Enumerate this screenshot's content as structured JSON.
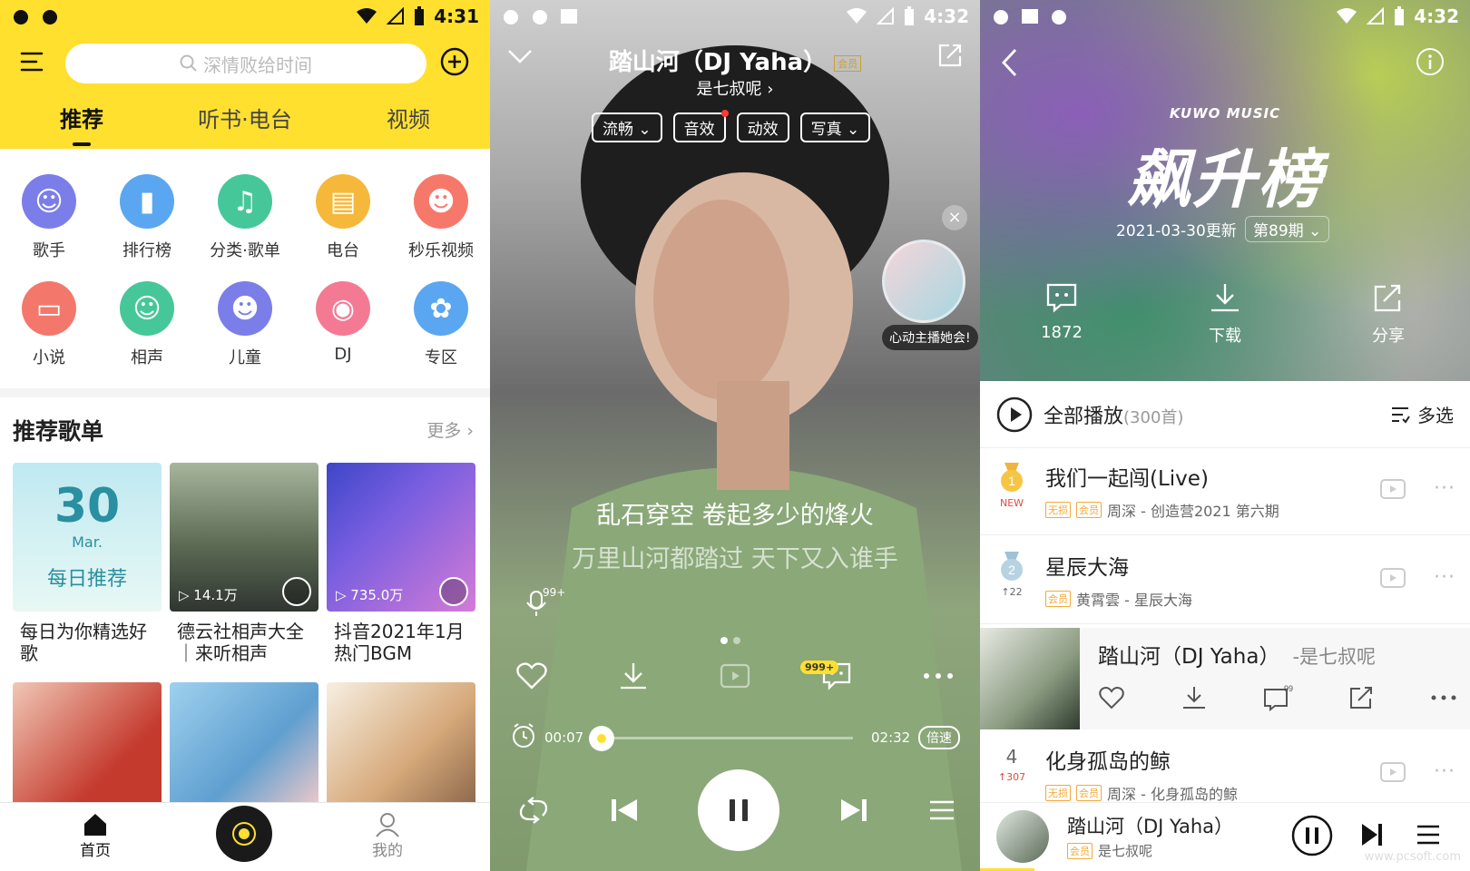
{
  "colors": {
    "accent": "#ffe02f",
    "text": "#222222",
    "muted": "#999999",
    "vip": "#f2a93b"
  },
  "status": {
    "time1": "4:31",
    "time2": "4:32",
    "time3": "4:32"
  },
  "home": {
    "search_placeholder": "深情败给时间",
    "tabs": [
      "推荐",
      "听书·电台",
      "视频"
    ],
    "categories": [
      {
        "label": "歌手",
        "icon": "singer-icon",
        "color": "#7b7ee8"
      },
      {
        "label": "排行榜",
        "icon": "chart-icon",
        "color": "#5ba6f0"
      },
      {
        "label": "分类·歌单",
        "icon": "playlist-icon",
        "color": "#46c79a"
      },
      {
        "label": "电台",
        "icon": "radio-icon",
        "color": "#f6b83a"
      },
      {
        "label": "秒乐视频",
        "icon": "video-icon",
        "color": "#f6786a"
      },
      {
        "label": "小说",
        "icon": "novel-icon",
        "color": "#f4776c"
      },
      {
        "label": "相声",
        "icon": "crosstalk-icon",
        "color": "#46c79a"
      },
      {
        "label": "儿童",
        "icon": "kids-icon",
        "color": "#7b7ee8"
      },
      {
        "label": "DJ",
        "icon": "dj-icon",
        "color": "#f47a94"
      },
      {
        "label": "专区",
        "icon": "zone-icon",
        "color": "#5ba6f0"
      }
    ],
    "section_title": "推荐歌单",
    "section_more": "更多",
    "cards": [
      {
        "title": "每日为你精选好歌",
        "plays": "",
        "date_num": "30",
        "date_month": "Mar.",
        "date_label": "每日推荐"
      },
      {
        "title": "德云社相声大全｜来听相声",
        "plays": "▷ 14.1万"
      },
      {
        "title": "抖音2021年1月热门BGM",
        "plays": "▷ 735.0万"
      }
    ],
    "nav_home": "首页",
    "nav_mine": "我的"
  },
  "player": {
    "title": "踏山河（DJ Yaha）",
    "vip": "会员",
    "artist": "是七叔呢",
    "chips": [
      "流畅",
      "音效",
      "动效",
      "写真"
    ],
    "live_label": "心动主播她会!",
    "close": "×",
    "lyric_current": "乱石穿空 卷起多少的烽火",
    "lyric_next": "万里山河都踏过 天下又入谁手",
    "mic_count": "99+",
    "comment_badge": "999+",
    "time_current": "00:07",
    "time_total": "02:32",
    "speed": "倍速",
    "progress": 0.046
  },
  "chart": {
    "brand": "KUWO MUSIC",
    "title": "飙升榜",
    "updated": "2021-03-30更新",
    "issue": "第89期",
    "comments": "1872",
    "download": "下载",
    "share": "分享",
    "play_all": "全部播放",
    "play_all_count": "(300首)",
    "multi_select": "多选",
    "songs": [
      {
        "rank": "1",
        "sub": "NEW",
        "name": "我们一起闯(Live)",
        "tags": [
          "无损",
          "会员"
        ],
        "meta": "周深 - 创造营2021 第六期"
      },
      {
        "rank": "2",
        "sub": "↑22",
        "name": "星辰大海",
        "tags": [
          "会员"
        ],
        "meta": "黄霄雲 - 星辰大海"
      },
      {
        "rank": "4",
        "sub": "↑307",
        "name": "化身孤岛的鲸",
        "tags": [
          "无损",
          "会员"
        ],
        "meta": "周深 - 化身孤岛的鲸"
      }
    ],
    "playing_name": "踏山河（DJ Yaha）",
    "playing_artist": "-是七叔呢",
    "playing_badge": "999+",
    "mini_title": "踏山河（DJ Yaha）",
    "mini_tag": "会员",
    "mini_artist": "是七叔呢",
    "watermark": "www.pcsoft.com"
  }
}
